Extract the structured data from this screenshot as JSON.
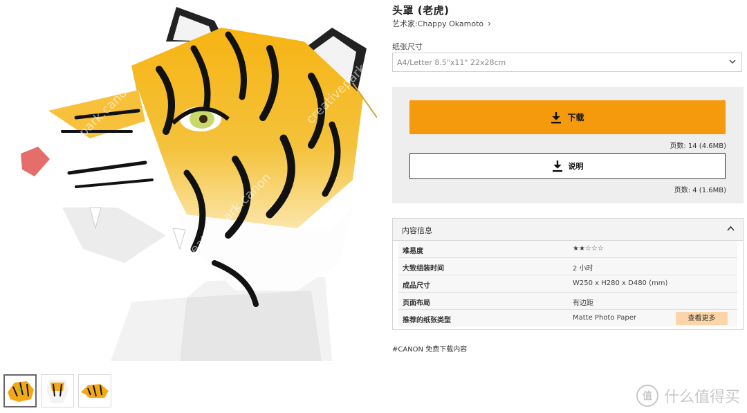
{
  "product": {
    "title": "头罩 (老虎)",
    "artist": "艺术家:Chappy Okamoto",
    "artist_chevron": "›"
  },
  "paper": {
    "label": "纸张尺寸",
    "selected": "A4/Letter 8.5\"x11\" 22x28cm"
  },
  "download": {
    "download_label": "下载",
    "download_meta": "页数: 14 (4.6MB)",
    "manual_label": "说明",
    "manual_meta": "页数: 4 (1.6MB)"
  },
  "info": {
    "heading": "内容信息",
    "rows": [
      {
        "key": "难易度",
        "value": "★★☆☆☆"
      },
      {
        "key": "大致组装时间",
        "value": "2 小时"
      },
      {
        "key": "成品尺寸",
        "value": "W250 x H280 x D480 (mm)"
      },
      {
        "key": "页面布局",
        "value": "有边距"
      },
      {
        "key": "推荐的纸张类型",
        "value": "Matte Photo Paper"
      }
    ],
    "more_label": "查看更多"
  },
  "tag": "#CANON 免费下载内容",
  "image_watermark": "creativepark.canon",
  "watermark": {
    "circle_char": "值",
    "text": "什么值得买"
  },
  "colors": {
    "accent": "#f59a0c",
    "tiger_orange": "#f3a916",
    "more_button_bg": "#fbd4a8"
  }
}
